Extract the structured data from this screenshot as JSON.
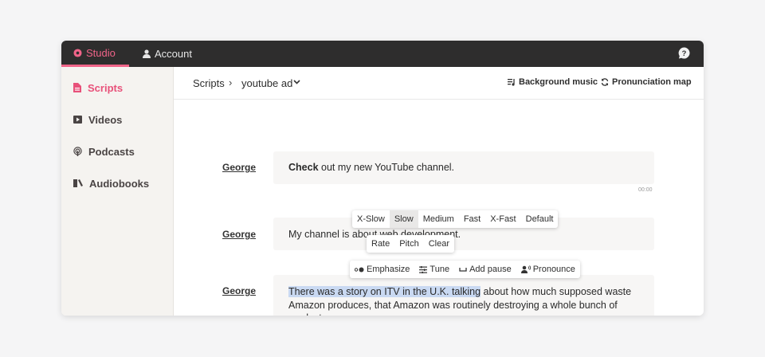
{
  "topbar": {
    "tabs": [
      {
        "label": "Studio",
        "icon": "gear-icon",
        "active": true
      },
      {
        "label": "Account",
        "icon": "person-icon",
        "active": false
      }
    ],
    "help_icon": "help-icon"
  },
  "colors": {
    "accent": "#f06489",
    "topbar_bg": "#2e2d2d",
    "sidebar_bg": "#f5f3f0",
    "highlight": "#c9d9f2"
  },
  "sidebar": {
    "items": [
      {
        "label": "Scripts",
        "icon": "document-icon",
        "active": true
      },
      {
        "label": "Videos",
        "icon": "video-icon",
        "active": false
      },
      {
        "label": "Podcasts",
        "icon": "podcast-icon",
        "active": false
      },
      {
        "label": "Audiobooks",
        "icon": "book-icon",
        "active": false
      }
    ]
  },
  "breadcrumb": {
    "root": "Scripts",
    "separator": "›",
    "current": "youtube ad"
  },
  "toolbar": {
    "background_music": "Background music",
    "pronunciation_map": "Pronunciation map"
  },
  "lines": [
    {
      "speaker": "George",
      "bold": "Check",
      "text": " out my new YouTube channel.",
      "time": "00:00"
    },
    {
      "speaker": "George",
      "text": "My channel is about web development."
    },
    {
      "speaker": "George",
      "highlight": "There was a story on ITV in the U.K. talking",
      "text": " about how much supposed waste Amazon produces, that Amazon was routinely destroying a whole bunch of products."
    }
  ],
  "rate_menu": {
    "options": [
      "X-Slow",
      "Slow",
      "Medium",
      "Fast",
      "X-Fast",
      "Default"
    ],
    "selected": "Slow"
  },
  "tune_menu": {
    "options": [
      "Rate",
      "Pitch",
      "Clear"
    ]
  },
  "format_menu": {
    "emphasize": "Emphasize",
    "tune": "Tune",
    "add_pause": "Add pause",
    "pronounce": "Pronounce"
  }
}
